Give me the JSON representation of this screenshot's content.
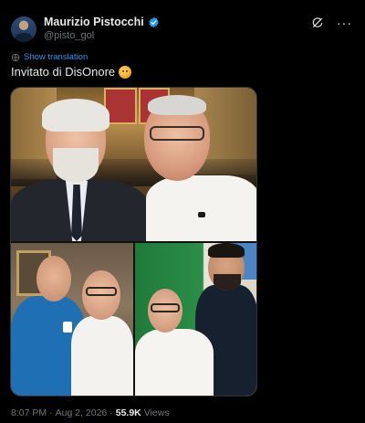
{
  "author": {
    "display_name": "Maurizio Pistocchi",
    "handle": "@pisto_gol",
    "verified": true
  },
  "actions": {
    "grok_icon": "grok-icon",
    "more_label": "···"
  },
  "translation": {
    "icon": "globe-icon",
    "label": "Show translation"
  },
  "tweet": {
    "text": "Invitato di DisOnore"
  },
  "media": {
    "photo_count": 3
  },
  "meta": {
    "time": "8:07 PM",
    "separator": "·",
    "date": "Aug 2, 2026",
    "separator2": "·",
    "views": "55.9K",
    "views_label": "Views"
  },
  "colors": {
    "background": "#000000",
    "text": "#e7e9ea",
    "secondary": "#71767b",
    "link": "#1d9bf0",
    "verified": "#1d9bf0"
  }
}
